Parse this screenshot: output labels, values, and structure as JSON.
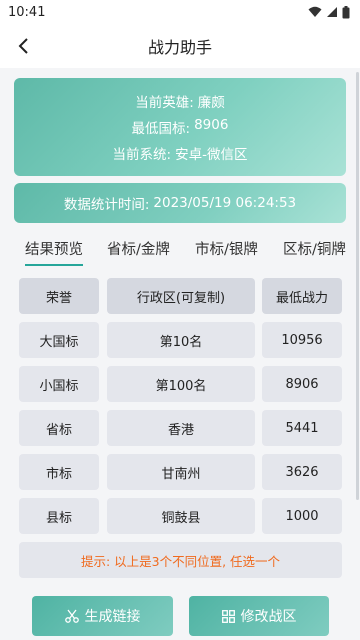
{
  "status_bar": {
    "time": "10:41"
  },
  "app_bar": {
    "title": "战力助手"
  },
  "info": {
    "hero_label": "当前英雄:",
    "hero_value": "廉颇",
    "min_label": "最低国标:",
    "min_value": "8906",
    "system_label": "当前系统:",
    "system_value": "安卓-微信区"
  },
  "stats_time": {
    "label": "数据统计时间:",
    "value": "2023/05/19 06:24:53"
  },
  "tabs": [
    {
      "label": "结果预览",
      "active": true
    },
    {
      "label": "省标/金牌",
      "active": false
    },
    {
      "label": "市标/银牌",
      "active": false
    },
    {
      "label": "区标/铜牌",
      "active": false
    }
  ],
  "table": {
    "headers": [
      "荣誉",
      "行政区(可复制)",
      "最低战力"
    ],
    "rows": [
      [
        "大国标",
        "第10名",
        "10956"
      ],
      [
        "小国标",
        "第100名",
        "8906"
      ],
      [
        "省标",
        "香港",
        "5441"
      ],
      [
        "市标",
        "甘南州",
        "3626"
      ],
      [
        "县标",
        "铜鼓县",
        "1000"
      ]
    ]
  },
  "tip": "提示: 以上是3个不同位置, 任选一个",
  "buttons": {
    "generate": "生成链接",
    "edit": "修改战区"
  },
  "colors": {
    "accent": "#26a69a",
    "tip": "#f06a1e"
  }
}
